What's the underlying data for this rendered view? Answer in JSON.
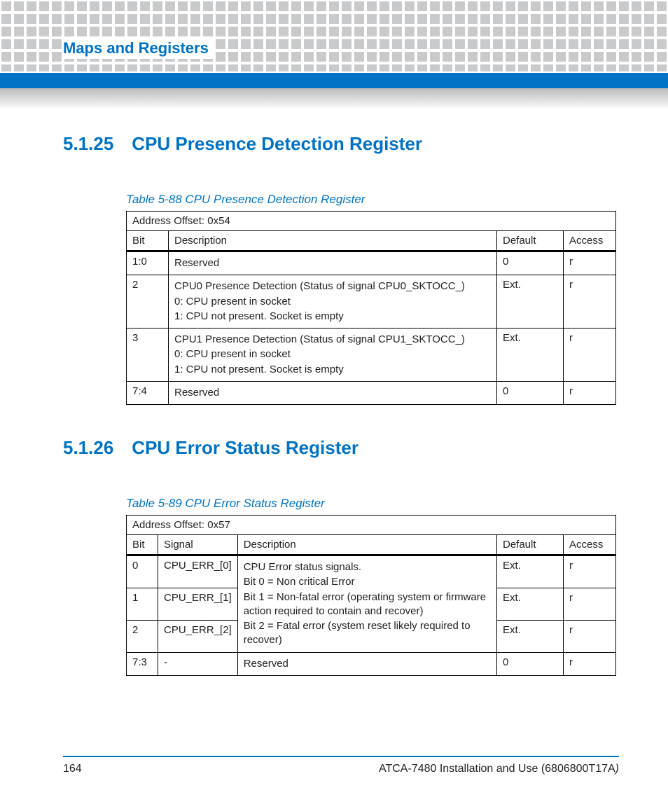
{
  "header": {
    "title": "Maps and Registers"
  },
  "sections": [
    {
      "num": "5.1.25",
      "title": "CPU Presence Detection Register",
      "table_caption": "Table 5-88 CPU Presence Detection Register",
      "address_offset": "Address Offset: 0x54",
      "columns": {
        "c0": "Bit",
        "c1": "Description",
        "c2": "Default",
        "c3": "Access"
      },
      "rows": [
        {
          "bit": "1:0",
          "desc": [
            "Reserved"
          ],
          "def": "0",
          "acc": "r"
        },
        {
          "bit": "2",
          "desc": [
            "CPU0 Presence Detection (Status of signal CPU0_SKTOCC_)",
            "0: CPU present in socket",
            "1: CPU not present. Socket is empty"
          ],
          "def": "Ext.",
          "acc": "r"
        },
        {
          "bit": "3",
          "desc": [
            "CPU1 Presence Detection (Status of signal CPU1_SKTOCC_)",
            "0: CPU present in socket",
            "1: CPU not present. Socket is empty"
          ],
          "def": "Ext.",
          "acc": "r"
        },
        {
          "bit": "7:4",
          "desc": [
            "Reserved"
          ],
          "def": "0",
          "acc": "r"
        }
      ]
    },
    {
      "num": "5.1.26",
      "title": "CPU Error Status Register",
      "table_caption": "Table 5-89 CPU Error Status Register",
      "address_offset": "Address Offset: 0x57",
      "columns": {
        "c0": "Bit",
        "c1": "Signal",
        "c2": "Description",
        "c3": "Default",
        "c4": "Access"
      },
      "shared_desc": [
        "CPU Error status signals.",
        "Bit 0 = Non critical Error",
        "Bit 1 = Non-fatal error (operating system or firmware action required to contain and recover)",
        "Bit 2 = Fatal error (system reset likely required to recover)"
      ],
      "rows": [
        {
          "bit": "0",
          "sig": "CPU_ERR_[0]",
          "def": "Ext.",
          "acc": "r"
        },
        {
          "bit": "1",
          "sig": "CPU_ERR_[1]",
          "def": "Ext.",
          "acc": "r"
        },
        {
          "bit": "2",
          "sig": "CPU_ERR_[2]",
          "def": "Ext.",
          "acc": "r"
        },
        {
          "bit": "7:3",
          "sig": "-",
          "desc": [
            "Reserved"
          ],
          "def": "0",
          "acc": "r"
        }
      ]
    }
  ],
  "footer": {
    "page": "164",
    "doc": "ATCA-7480 Installation and Use (6806800T17A",
    "doc_tail": ")"
  }
}
